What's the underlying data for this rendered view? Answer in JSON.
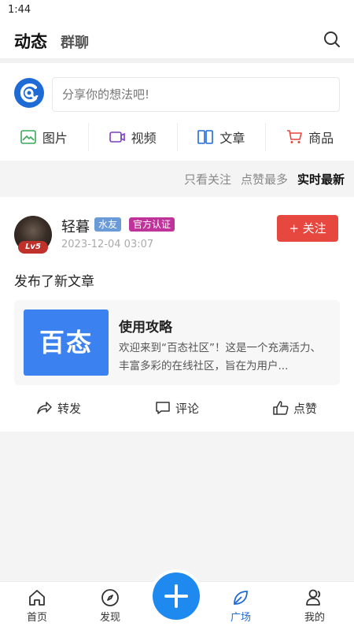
{
  "status": {
    "time": "1:44"
  },
  "header": {
    "tab_main": "动态",
    "tab_secondary": "群聊"
  },
  "composer": {
    "placeholder": "分享你的想法吧!",
    "types": [
      {
        "label": "图片",
        "icon": "image-icon"
      },
      {
        "label": "视频",
        "icon": "video-icon"
      },
      {
        "label": "文章",
        "icon": "article-icon"
      },
      {
        "label": "商品",
        "icon": "cart-icon"
      }
    ]
  },
  "filters": {
    "items": [
      "只看关注",
      "点赞最多",
      "实时最新"
    ]
  },
  "post": {
    "username": "轻暮",
    "level": "Lv5",
    "badges": [
      "水友",
      "官方认证"
    ],
    "timestamp": "2023-12-04 03:07",
    "follow_label": "+ 关注",
    "text": "发布了新文章",
    "article": {
      "thumb_text": "百态",
      "title": "使用攻略",
      "desc": "欢迎来到“百态社区”！这是一个充满活力、丰富多彩的在线社区，旨在为用户..."
    },
    "actions": [
      "转发",
      "评论",
      "点赞"
    ]
  },
  "tabbar": {
    "items": [
      "首页",
      "发现",
      "广场",
      "我的"
    ]
  },
  "colors": {
    "primary": "#1e6bd6",
    "follow": "#e6473f",
    "badge_1": "#6a9bd8",
    "badge_2": "#c0339b"
  }
}
